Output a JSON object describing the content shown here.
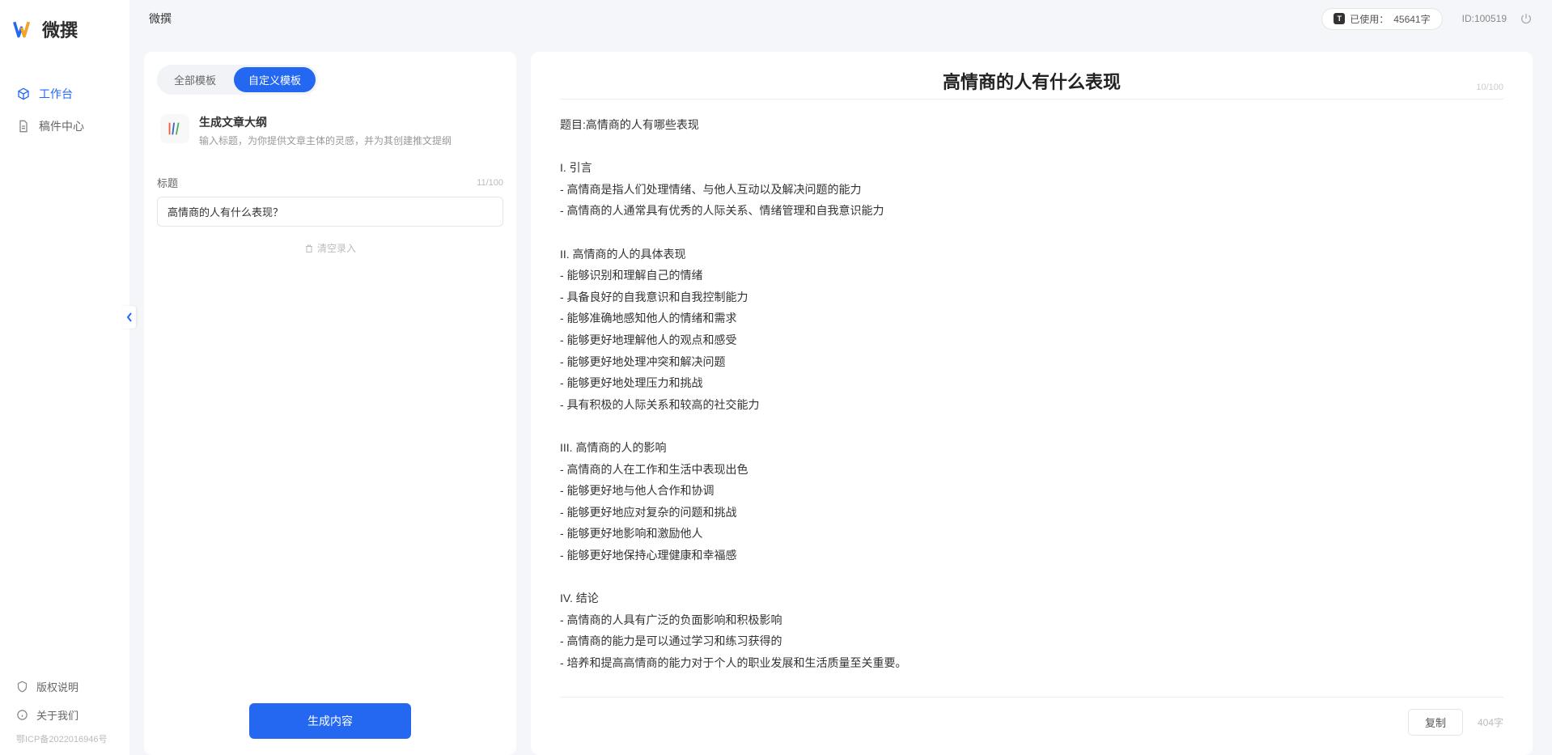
{
  "app": {
    "name": "微撰",
    "topbar_title": "微撰",
    "usage_prefix": "已使用：",
    "usage_value": "45641字",
    "id_label": "ID:100519"
  },
  "sidebar": {
    "nav": [
      {
        "label": "工作台",
        "icon": "cube"
      },
      {
        "label": "稿件中心",
        "icon": "doc"
      }
    ],
    "footer": [
      {
        "label": "版权说明",
        "icon": "shield"
      },
      {
        "label": "关于我们",
        "icon": "info"
      }
    ],
    "icp": "鄂ICP备2022016946号"
  },
  "tabs": [
    {
      "label": "全部模板",
      "active": false
    },
    {
      "label": "自定义模板",
      "active": true
    }
  ],
  "template": {
    "title": "生成文章大纲",
    "desc": "输入标题，为你提供文章主体的灵感，并为其创建推文提纲"
  },
  "form": {
    "title_label": "标题",
    "title_counter": "11/100",
    "title_value": "高情商的人有什么表现？",
    "clear_label": "清空录入",
    "generate_label": "生成内容"
  },
  "output": {
    "title": "高情商的人有什么表现",
    "title_counter": "10/100",
    "body": "题目:高情商的人有哪些表现\n\nI. 引言\n- 高情商是指人们处理情绪、与他人互动以及解决问题的能力\n- 高情商的人通常具有优秀的人际关系、情绪管理和自我意识能力\n\nII. 高情商的人的具体表现\n- 能够识别和理解自己的情绪\n- 具备良好的自我意识和自我控制能力\n- 能够准确地感知他人的情绪和需求\n- 能够更好地理解他人的观点和感受\n- 能够更好地处理冲突和解决问题\n- 能够更好地处理压力和挑战\n- 具有积极的人际关系和较高的社交能力\n\nIII. 高情商的人的影响\n- 高情商的人在工作和生活中表现出色\n- 能够更好地与他人合作和协调\n- 能够更好地应对复杂的问题和挑战\n- 能够更好地影响和激励他人\n- 能够更好地保持心理健康和幸福感\n\nIV. 结论\n- 高情商的人具有广泛的负面影响和积极影响\n- 高情商的能力是可以通过学习和练习获得的\n- 培养和提高高情商的能力对于个人的职业发展和生活质量至关重要。",
    "copy_label": "复制",
    "char_count": "404字"
  }
}
